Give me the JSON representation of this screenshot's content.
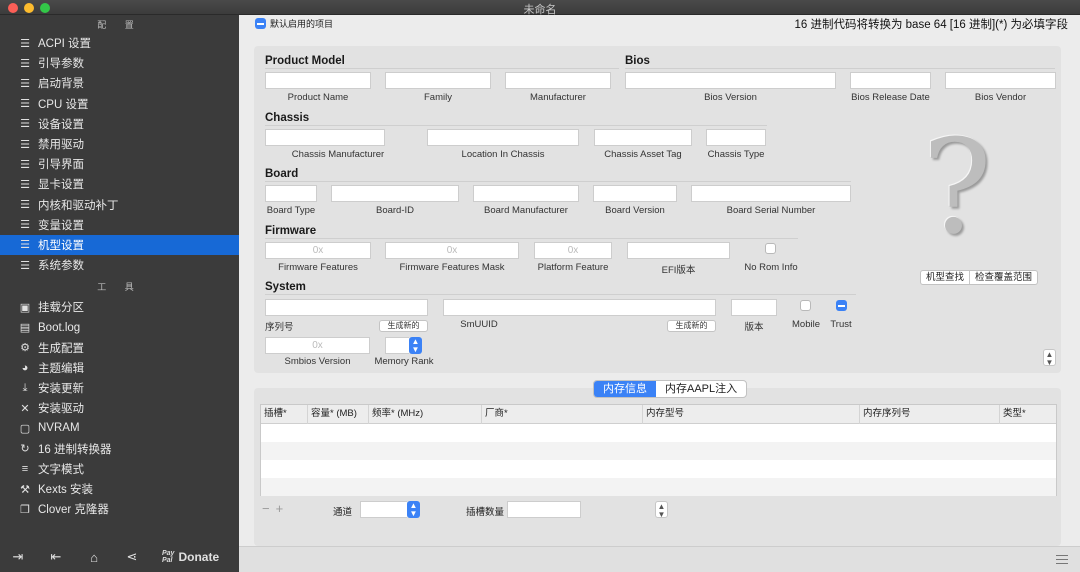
{
  "window": {
    "title": "未命名"
  },
  "sidebar": {
    "config_header": "配 置",
    "config_items": [
      {
        "label": "ACPI 设置",
        "icon": "list-icon"
      },
      {
        "label": "引导参数",
        "icon": "list-icon"
      },
      {
        "label": "启动背景",
        "icon": "list-icon"
      },
      {
        "label": "CPU 设置",
        "icon": "list-icon"
      },
      {
        "label": "设备设置",
        "icon": "list-icon"
      },
      {
        "label": "禁用驱动",
        "icon": "list-icon"
      },
      {
        "label": "引导界面",
        "icon": "list-icon"
      },
      {
        "label": "显卡设置",
        "icon": "list-icon"
      },
      {
        "label": "内核和驱动补丁",
        "icon": "list-icon"
      },
      {
        "label": "变量设置",
        "icon": "list-icon"
      },
      {
        "label": "机型设置",
        "icon": "list-icon",
        "active": true
      },
      {
        "label": "系统参数",
        "icon": "list-icon"
      }
    ],
    "tools_header": "工 具",
    "tool_items": [
      {
        "label": "挂载分区",
        "icon": "disk-icon"
      },
      {
        "label": "Boot.log",
        "icon": "document-icon"
      },
      {
        "label": "生成配置",
        "icon": "gears-icon"
      },
      {
        "label": "主题编辑",
        "icon": "palette-icon"
      },
      {
        "label": "安装更新",
        "icon": "download-icon"
      },
      {
        "label": "安装驱动",
        "icon": "wrench-icon"
      },
      {
        "label": "NVRAM",
        "icon": "chip-icon"
      },
      {
        "label": "16 进制转换器",
        "icon": "refresh-icon"
      },
      {
        "label": "文字模式",
        "icon": "text-lines-icon"
      },
      {
        "label": "Kexts 安装",
        "icon": "hammer-icon"
      },
      {
        "label": "Clover 克隆器",
        "icon": "copy-icon"
      }
    ],
    "footer": {
      "donate_label": "Donate",
      "paypal_top": "Pay",
      "paypal_bottom": "Pal"
    }
  },
  "main": {
    "default_enabled_label": "默认启用的项目",
    "hex_note": "16 进制代码将转换为 base 64 [16 进制](*) 为必填字段",
    "sections": {
      "product_model": "Product Model",
      "bios": "Bios",
      "chassis": "Chassis",
      "board": "Board",
      "firmware": "Firmware",
      "system": "System"
    },
    "labels": {
      "product_name": "Product Name",
      "family": "Family",
      "manufacturer": "Manufacturer",
      "bios_version": "Bios Version",
      "bios_release_date": "Bios Release Date",
      "bios_vendor": "Bios Vendor",
      "chassis_manufacturer": "Chassis Manufacturer",
      "location_in_chassis": "Location In Chassis",
      "chassis_asset_tag": "Chassis  Asset Tag",
      "chassis_type": "Chassis Type",
      "board_type": "Board Type",
      "board_id": "Board-ID",
      "board_manufacturer": "Board Manufacturer",
      "board_version": "Board Version",
      "board_serial_number": "Board Serial Number",
      "firmware_features": "Firmware Features",
      "firmware_features_mask": "Firmware Features Mask",
      "platform_feature": "Platform Feature",
      "efi_version": "EFI版本",
      "no_rom_info": "No Rom Info",
      "serial_number": "序列号",
      "smuuid": "SmUUID",
      "version": "版本",
      "mobile": "Mobile",
      "trust": "Trust",
      "smbios_version": "Smbios Version",
      "memory_rank": "Memory Rank"
    },
    "placeholders": {
      "firmware_features": "0x",
      "firmware_features_mask": "0x",
      "platform_feature": "0x",
      "smbios_version": "0x"
    },
    "buttons": {
      "generate_new_1": "生成新的",
      "generate_new_2": "生成新的",
      "model_lookup": "机型查找",
      "check_coverage": "检查覆盖范围"
    },
    "memory": {
      "tabs": [
        "内存信息",
        "内存AAPL注入"
      ],
      "columns": [
        "插槽*",
        "容量* (MB)",
        "频率* (MHz)",
        "厂商*",
        "内存型号",
        "内存序列号",
        "类型*"
      ],
      "channels_label": "通道",
      "slot_count_label": "插槽数量"
    }
  }
}
